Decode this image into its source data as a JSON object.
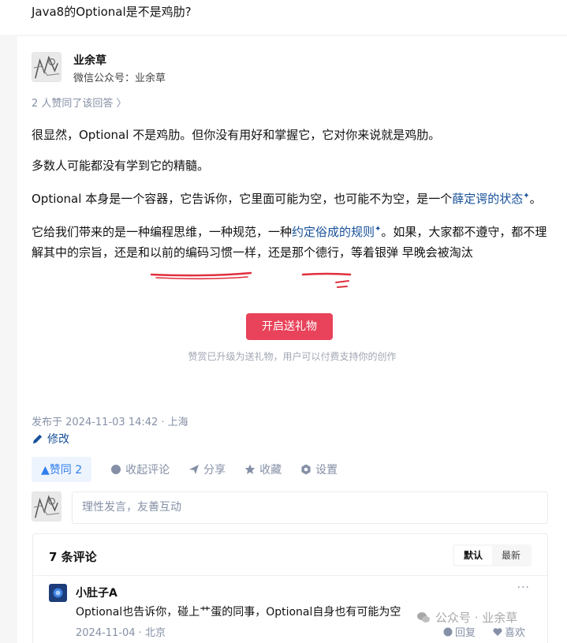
{
  "question": {
    "title": "Java8的Optional是不是鸡肋?"
  },
  "author": {
    "name": "业余草",
    "description": "微信公众号：业余草"
  },
  "voters_text": "2 人赞同了该回答 〉",
  "content": {
    "p1": "很显然，Optional 不是鸡肋。但你没有用好和掌握它，它对你来说就是鸡肋。",
    "p2": "多数人可能都没有学到它的精髓。",
    "p3_before": "Optional 本身是一个容器，它告诉你，它里面可能为空，也可能不为空，是一个",
    "p3_keyword": "薛定谔的状态",
    "p3_after": "。",
    "p4_before": "它给我们带来的是一种编程思维，一种规范，一种",
    "p4_keyword": "约定俗成的规则",
    "p4_after": "。如果，大家都不遵守，都不理解其中的宗旨，还是和以前的编码习惯一样，还是那个德行，等着银弹 早晚会被淘汰",
    "star": "✦"
  },
  "gift": {
    "button": "开启送礼物",
    "tip": "赞赏已升级为送礼物，用户可以付费支持你的创作"
  },
  "publish_time": "发布于 2024-11-03 14:42 · 上海",
  "edit_label": "修改",
  "actions": {
    "vote": "▲赞同 2",
    "collapse_comments": "收起评论",
    "share": "分享",
    "favorite": "收藏",
    "settings": "设置"
  },
  "comment_input": {
    "placeholder": "理性发言，友善互动"
  },
  "comments": {
    "count_label": "7 条评论",
    "sort": {
      "default": "默认",
      "latest": "最新"
    },
    "items": [
      {
        "name": "小肚子A",
        "text": "Optional也告诉你，碰上艹蛋的同事，Optional自身也有可能为空",
        "meta": "2024-11-04 · 北京",
        "reply": "回复",
        "like": "喜欢",
        "more": "···"
      }
    ]
  },
  "watermark": "公众号 · 业余草",
  "colors": {
    "accent": "#175199",
    "vote_blue": "#2f7eed",
    "gift_red": "#e8435a",
    "annotation_red": "#e0303e"
  }
}
